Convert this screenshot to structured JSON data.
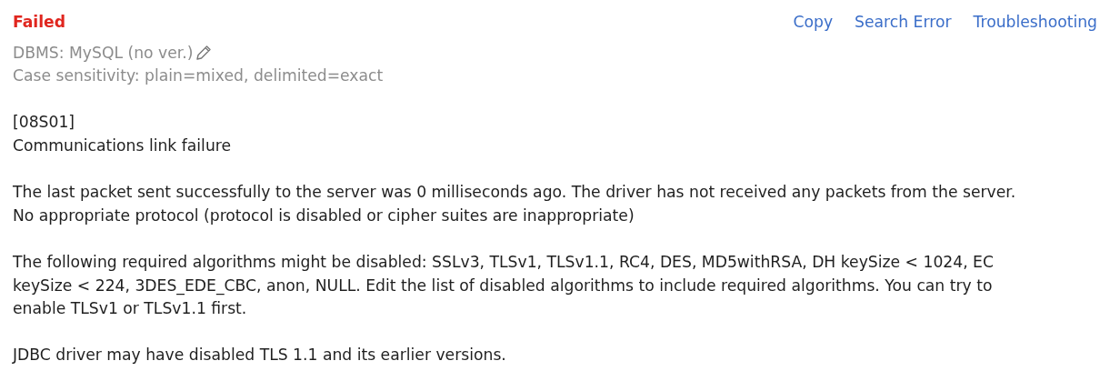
{
  "status": "Failed",
  "actions": [
    "Copy",
    "Search Error",
    "Troubleshooting"
  ],
  "info_lines": [
    {
      "text": "DBMS: MySQL (no ver.)",
      "editable": true
    },
    {
      "text": "Case sensitivity: plain=mixed, delimited=exact",
      "editable": false
    }
  ],
  "message": [
    [
      "[08S01]",
      "Communications link failure"
    ],
    [
      "The last packet sent successfully to the server was 0 milliseconds ago. The driver has not received any packets from the server.",
      "No appropriate protocol (protocol is disabled or cipher suites are inappropriate)"
    ],
    [
      "The following required algorithms might be disabled: SSLv3, TLSv1, TLSv1.1, RC4, DES, MD5withRSA, DH keySize < 1024, EC keySize < 224, 3DES_EDE_CBC, anon, NULL. Edit the list of disabled algorithms to include required algorithms. You can try to enable TLSv1 or TLSv1.1 first."
    ],
    [
      "JDBC driver may have disabled TLS 1.1 and its earlier versions."
    ]
  ]
}
